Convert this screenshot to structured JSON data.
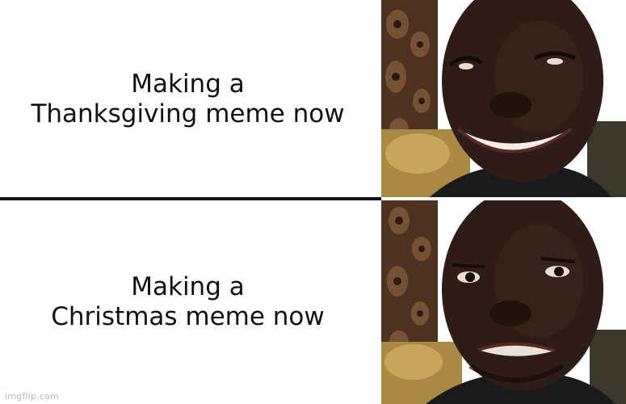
{
  "panels": [
    {
      "caption_line1": "Making a",
      "caption_line2": "Thanksgiving meme now",
      "expression": "happy"
    },
    {
      "caption_line1": "Making a",
      "caption_line2": "Christmas meme now",
      "expression": "disappointed"
    }
  ],
  "watermark": "imgflip.com",
  "colors": {
    "background": "#ffffff",
    "text": "#111111",
    "divider": "#111111",
    "skin": "#2e1d16",
    "wood": "#5a3b22",
    "sofa": "#a88a45"
  }
}
